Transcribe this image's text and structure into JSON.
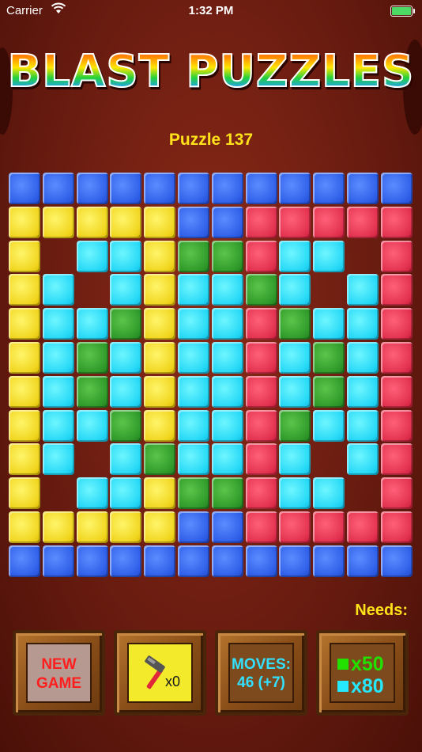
{
  "status_bar": {
    "carrier": "Carrier",
    "time": "1:32 PM"
  },
  "title": "BLAST PUZZLES",
  "puzzle_label": "Puzzle 137",
  "colors": {
    "B": "#2f5fe8",
    "Y": "#f1d61f",
    "R": "#e2324f",
    "C": "#25d8f6",
    "G": "#2f9a2a"
  },
  "board": [
    "BBBBBBBBBBBB",
    "YYYYYBBRRRRR",
    "Y.CCYGGRCC.R",
    "YC.CYCCGC.CR",
    "YCCGYCCRGCCR",
    "YCGCYCCRCGCR",
    "YCGCYCCRCGCR",
    "YCCGYCCRGCCR",
    "YC.CGCCRC.CR",
    "Y.CCYGGRCC.R",
    "YYYYYBBRRRRR",
    "BBBBBBBBBBBB"
  ],
  "needs_label": "Needs:",
  "buttons": {
    "new_game_line1": "NEW",
    "new_game_line2": "GAME",
    "hammer_count": "x0",
    "moves_line1": "MOVES:",
    "moves_line2": "46 (+7)"
  },
  "needs": [
    {
      "color": "#22e000",
      "text": "x50"
    },
    {
      "color": "#25e8ff",
      "text": "x80"
    }
  ]
}
